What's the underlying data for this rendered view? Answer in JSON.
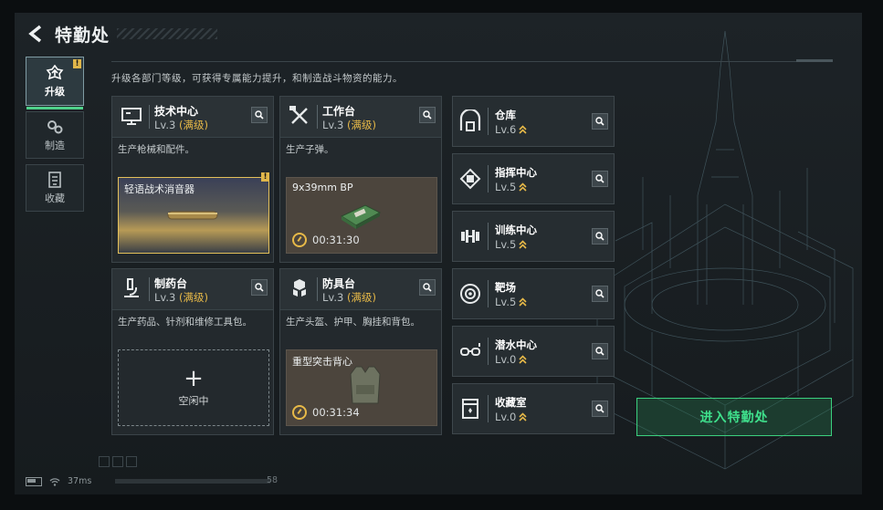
{
  "header": {
    "title": "特勤处"
  },
  "sidebar": {
    "items": [
      {
        "label": "升级",
        "badge": "!",
        "active": true,
        "icon": "upgrade-gear-icon"
      },
      {
        "label": "制造",
        "active": false,
        "icon": "craft-gears-icon"
      },
      {
        "label": "收藏",
        "active": false,
        "icon": "collection-icon"
      }
    ]
  },
  "description": "升级各部门等级，可获得专属能力提升，和制造战斗物资的能力。",
  "cards": [
    {
      "name": "技术中心",
      "level": "Lv.3",
      "max": "(满级)",
      "desc": "生产枪械和配件。",
      "slot": {
        "type": "item",
        "name": "轻语战术消音器",
        "badge": "!"
      }
    },
    {
      "name": "工作台",
      "level": "Lv.3",
      "max": "(满级)",
      "desc": "生产子弹。",
      "slot": {
        "type": "timer",
        "name": "9x39mm BP",
        "time": "00:31:30"
      }
    },
    {
      "name": "制药台",
      "level": "Lv.3",
      "max": "(满级)",
      "desc": "生产药品、针剂和维修工具包。",
      "slot": {
        "type": "empty",
        "plus": "+",
        "label": "空闲中"
      }
    },
    {
      "name": "防具台",
      "level": "Lv.3",
      "max": "(满级)",
      "desc": "生产头盔、护甲、胸挂和背包。",
      "slot": {
        "type": "timer",
        "name": "重型突击背心",
        "time": "00:31:34"
      }
    }
  ],
  "facilities": [
    {
      "name": "仓库",
      "level": "Lv.6",
      "icon": "warehouse-icon"
    },
    {
      "name": "指挥中心",
      "level": "Lv.5",
      "icon": "chip-icon"
    },
    {
      "name": "训练中心",
      "level": "Lv.5",
      "icon": "dumbbell-icon"
    },
    {
      "name": "靶场",
      "level": "Lv.5",
      "icon": "target-icon"
    },
    {
      "name": "潜水中心",
      "level": "Lv.0",
      "icon": "diving-goggles-icon"
    },
    {
      "name": "收藏室",
      "level": "Lv.0",
      "icon": "display-case-icon"
    }
  ],
  "enter_button": "进入特勤处",
  "status": {
    "ping": "37ms",
    "num": "58"
  },
  "colors": {
    "accent_gold": "#e7b948",
    "accent_green": "#3fe08c",
    "panel": "#23292d"
  }
}
